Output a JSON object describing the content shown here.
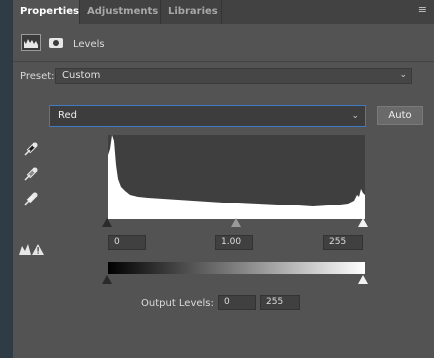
{
  "tabs": [
    {
      "label": "Properties",
      "active": true
    },
    {
      "label": "Adjustments",
      "active": false
    },
    {
      "label": "Libraries",
      "active": false
    }
  ],
  "header": {
    "title": "Levels",
    "histogram_icon": "histogram-icon",
    "mask_icon": "mask-icon"
  },
  "preset": {
    "label": "Preset:",
    "value": "Custom"
  },
  "channel": {
    "value": "Red",
    "auto_label": "Auto"
  },
  "tools": [
    "eyedropper-black-icon",
    "eyedropper-gray-icon",
    "eyedropper-white-icon"
  ],
  "input_levels": {
    "black": "0",
    "gamma": "1.00",
    "white": "255"
  },
  "output_levels": {
    "label": "Output Levels:",
    "black": "0",
    "white": "255"
  },
  "colors": {
    "accent": "#3e79c4",
    "panel_bg": "#535353",
    "tab_bg": "#424242"
  }
}
